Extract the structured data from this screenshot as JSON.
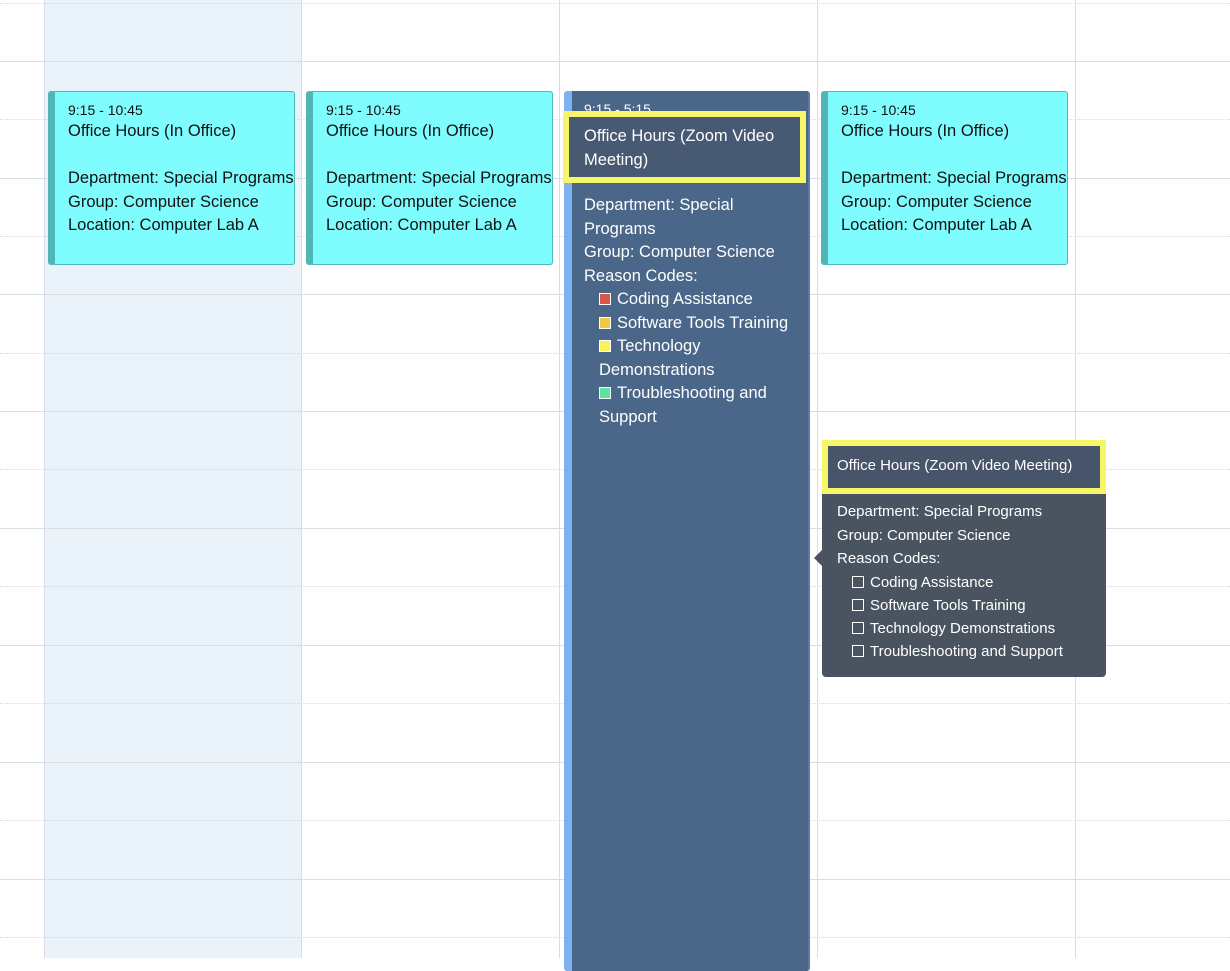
{
  "events": [
    {
      "time": "9:15 - 10:45",
      "title": "Office Hours (In Office)",
      "department": "Department: Special Programs",
      "group": "Group: Computer Science",
      "location": "Location: Computer Lab A"
    },
    {
      "time": "9:15 - 10:45",
      "title": "Office Hours (In Office)",
      "department": "Department: Special Programs",
      "group": "Group: Computer Science",
      "location": "Location: Computer Lab A"
    },
    {
      "time": "9:15 - 10:45",
      "title": "Office Hours (In Office)",
      "department": "Department: Special Programs",
      "group": "Group: Computer Science",
      "location": "Location: Computer Lab A"
    }
  ],
  "selected_event": {
    "time": "9:15 - 5:15",
    "title": "Office Hours (Zoom Video Meeting)",
    "department": "Department: Special Programs",
    "group": "Group: Computer Science",
    "reason_label": "Reason Codes:",
    "reasons": [
      {
        "label": "Coding Assistance",
        "color": "#d9574a"
      },
      {
        "label": "Software Tools Training",
        "color": "#f2c744"
      },
      {
        "label": "Technology Demonstrations",
        "color": "#f7f55a"
      },
      {
        "label": "Troubleshooting and Support",
        "color": "#5fe3a4"
      }
    ]
  },
  "popover": {
    "title": "Office Hours (Zoom Video Meeting)",
    "department": "Department: Special Programs",
    "group": "Group: Computer Science",
    "reason_label": "Reason Codes:",
    "reasons": [
      "Coding Assistance",
      "Software Tools Training",
      "Technology Demonstrations",
      "Troubleshooting and Support"
    ]
  },
  "colors": {
    "event_bg": "#7ffcfd",
    "selected_bg": "#4a6688",
    "highlight": "#f7f568",
    "today_bg": "#eaf2fa",
    "popover_bg": "#4a5461"
  }
}
